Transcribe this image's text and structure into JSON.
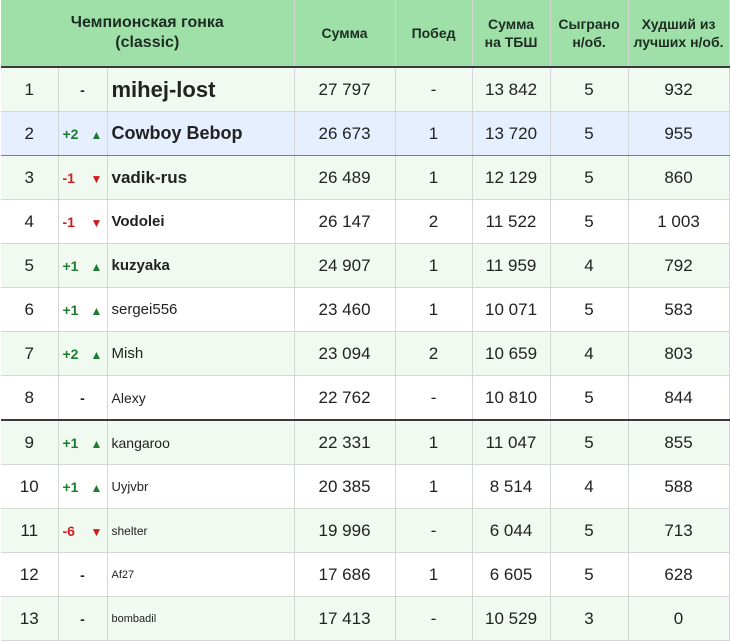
{
  "header": {
    "title_line1": "Чемпионская гонка",
    "title_line2": "(classic)",
    "col_sum": "Сумма",
    "col_wins": "Побед",
    "col_tbsh_line1": "Сумма",
    "col_tbsh_line2": "на ТБШ",
    "col_played_line1": "Сыграно",
    "col_played_line2": "н/об.",
    "col_worst_line1": "Худший из",
    "col_worst_line2": "лучших н/об."
  },
  "colors": {
    "header_bg": "#9fe0a9",
    "row_alt_bg": "#f1faf1",
    "selected_row_bg": "#e6efff",
    "selection_border": "#4a84d6",
    "up_color": "#1d7c2f",
    "down_color": "#d01818"
  },
  "rows": [
    {
      "pos": "1",
      "change": "-",
      "trend": "none",
      "name": "mihej-lost",
      "sum": "27 797",
      "wins": "-",
      "tbsh": "13 842",
      "played": "5",
      "worst": "932"
    },
    {
      "pos": "2",
      "change": "+2",
      "trend": "up",
      "name": "Cowboy Bebop",
      "sum": "26 673",
      "wins": "1",
      "tbsh": "13 720",
      "played": "5",
      "worst": "955"
    },
    {
      "pos": "3",
      "change": "-1",
      "trend": "down",
      "name": "vadik-rus",
      "sum": "26 489",
      "wins": "1",
      "tbsh": "12 129",
      "played": "5",
      "worst": "860"
    },
    {
      "pos": "4",
      "change": "-1",
      "trend": "down",
      "name": "Vodolei",
      "sum": "26 147",
      "wins": "2",
      "tbsh": "11 522",
      "played": "5",
      "worst": "1 003"
    },
    {
      "pos": "5",
      "change": "+1",
      "trend": "up",
      "name": "kuzyaka",
      "sum": "24 907",
      "wins": "1",
      "tbsh": "11 959",
      "played": "4",
      "worst": "792"
    },
    {
      "pos": "6",
      "change": "+1",
      "trend": "up",
      "name": "sergei556",
      "sum": "23 460",
      "wins": "1",
      "tbsh": "10 071",
      "played": "5",
      "worst": "583"
    },
    {
      "pos": "7",
      "change": "+2",
      "trend": "up",
      "name": "Mish",
      "sum": "23 094",
      "wins": "2",
      "tbsh": "10 659",
      "played": "4",
      "worst": "803"
    },
    {
      "pos": "8",
      "change": "-",
      "trend": "none",
      "name": "Alexy",
      "sum": "22 762",
      "wins": "-",
      "tbsh": "10 810",
      "played": "5",
      "worst": "844"
    },
    {
      "pos": "9",
      "change": "+1",
      "trend": "up",
      "name": "kangaroo",
      "sum": "22 331",
      "wins": "1",
      "tbsh": "11 047",
      "played": "5",
      "worst": "855"
    },
    {
      "pos": "10",
      "change": "+1",
      "trend": "up",
      "name": "Uyjvbr",
      "sum": "20 385",
      "wins": "1",
      "tbsh": "8 514",
      "played": "4",
      "worst": "588"
    },
    {
      "pos": "11",
      "change": "-6",
      "trend": "down",
      "name": "shelter",
      "sum": "19 996",
      "wins": "-",
      "tbsh": "6 044",
      "played": "5",
      "worst": "713"
    },
    {
      "pos": "12",
      "change": "-",
      "trend": "none",
      "name": "Af27",
      "sum": "17 686",
      "wins": "1",
      "tbsh": "6 605",
      "played": "5",
      "worst": "628"
    },
    {
      "pos": "13",
      "change": "-",
      "trend": "none",
      "name": "bombadil",
      "sum": "17 413",
      "wins": "-",
      "tbsh": "10 529",
      "played": "3",
      "worst": "0"
    }
  ]
}
